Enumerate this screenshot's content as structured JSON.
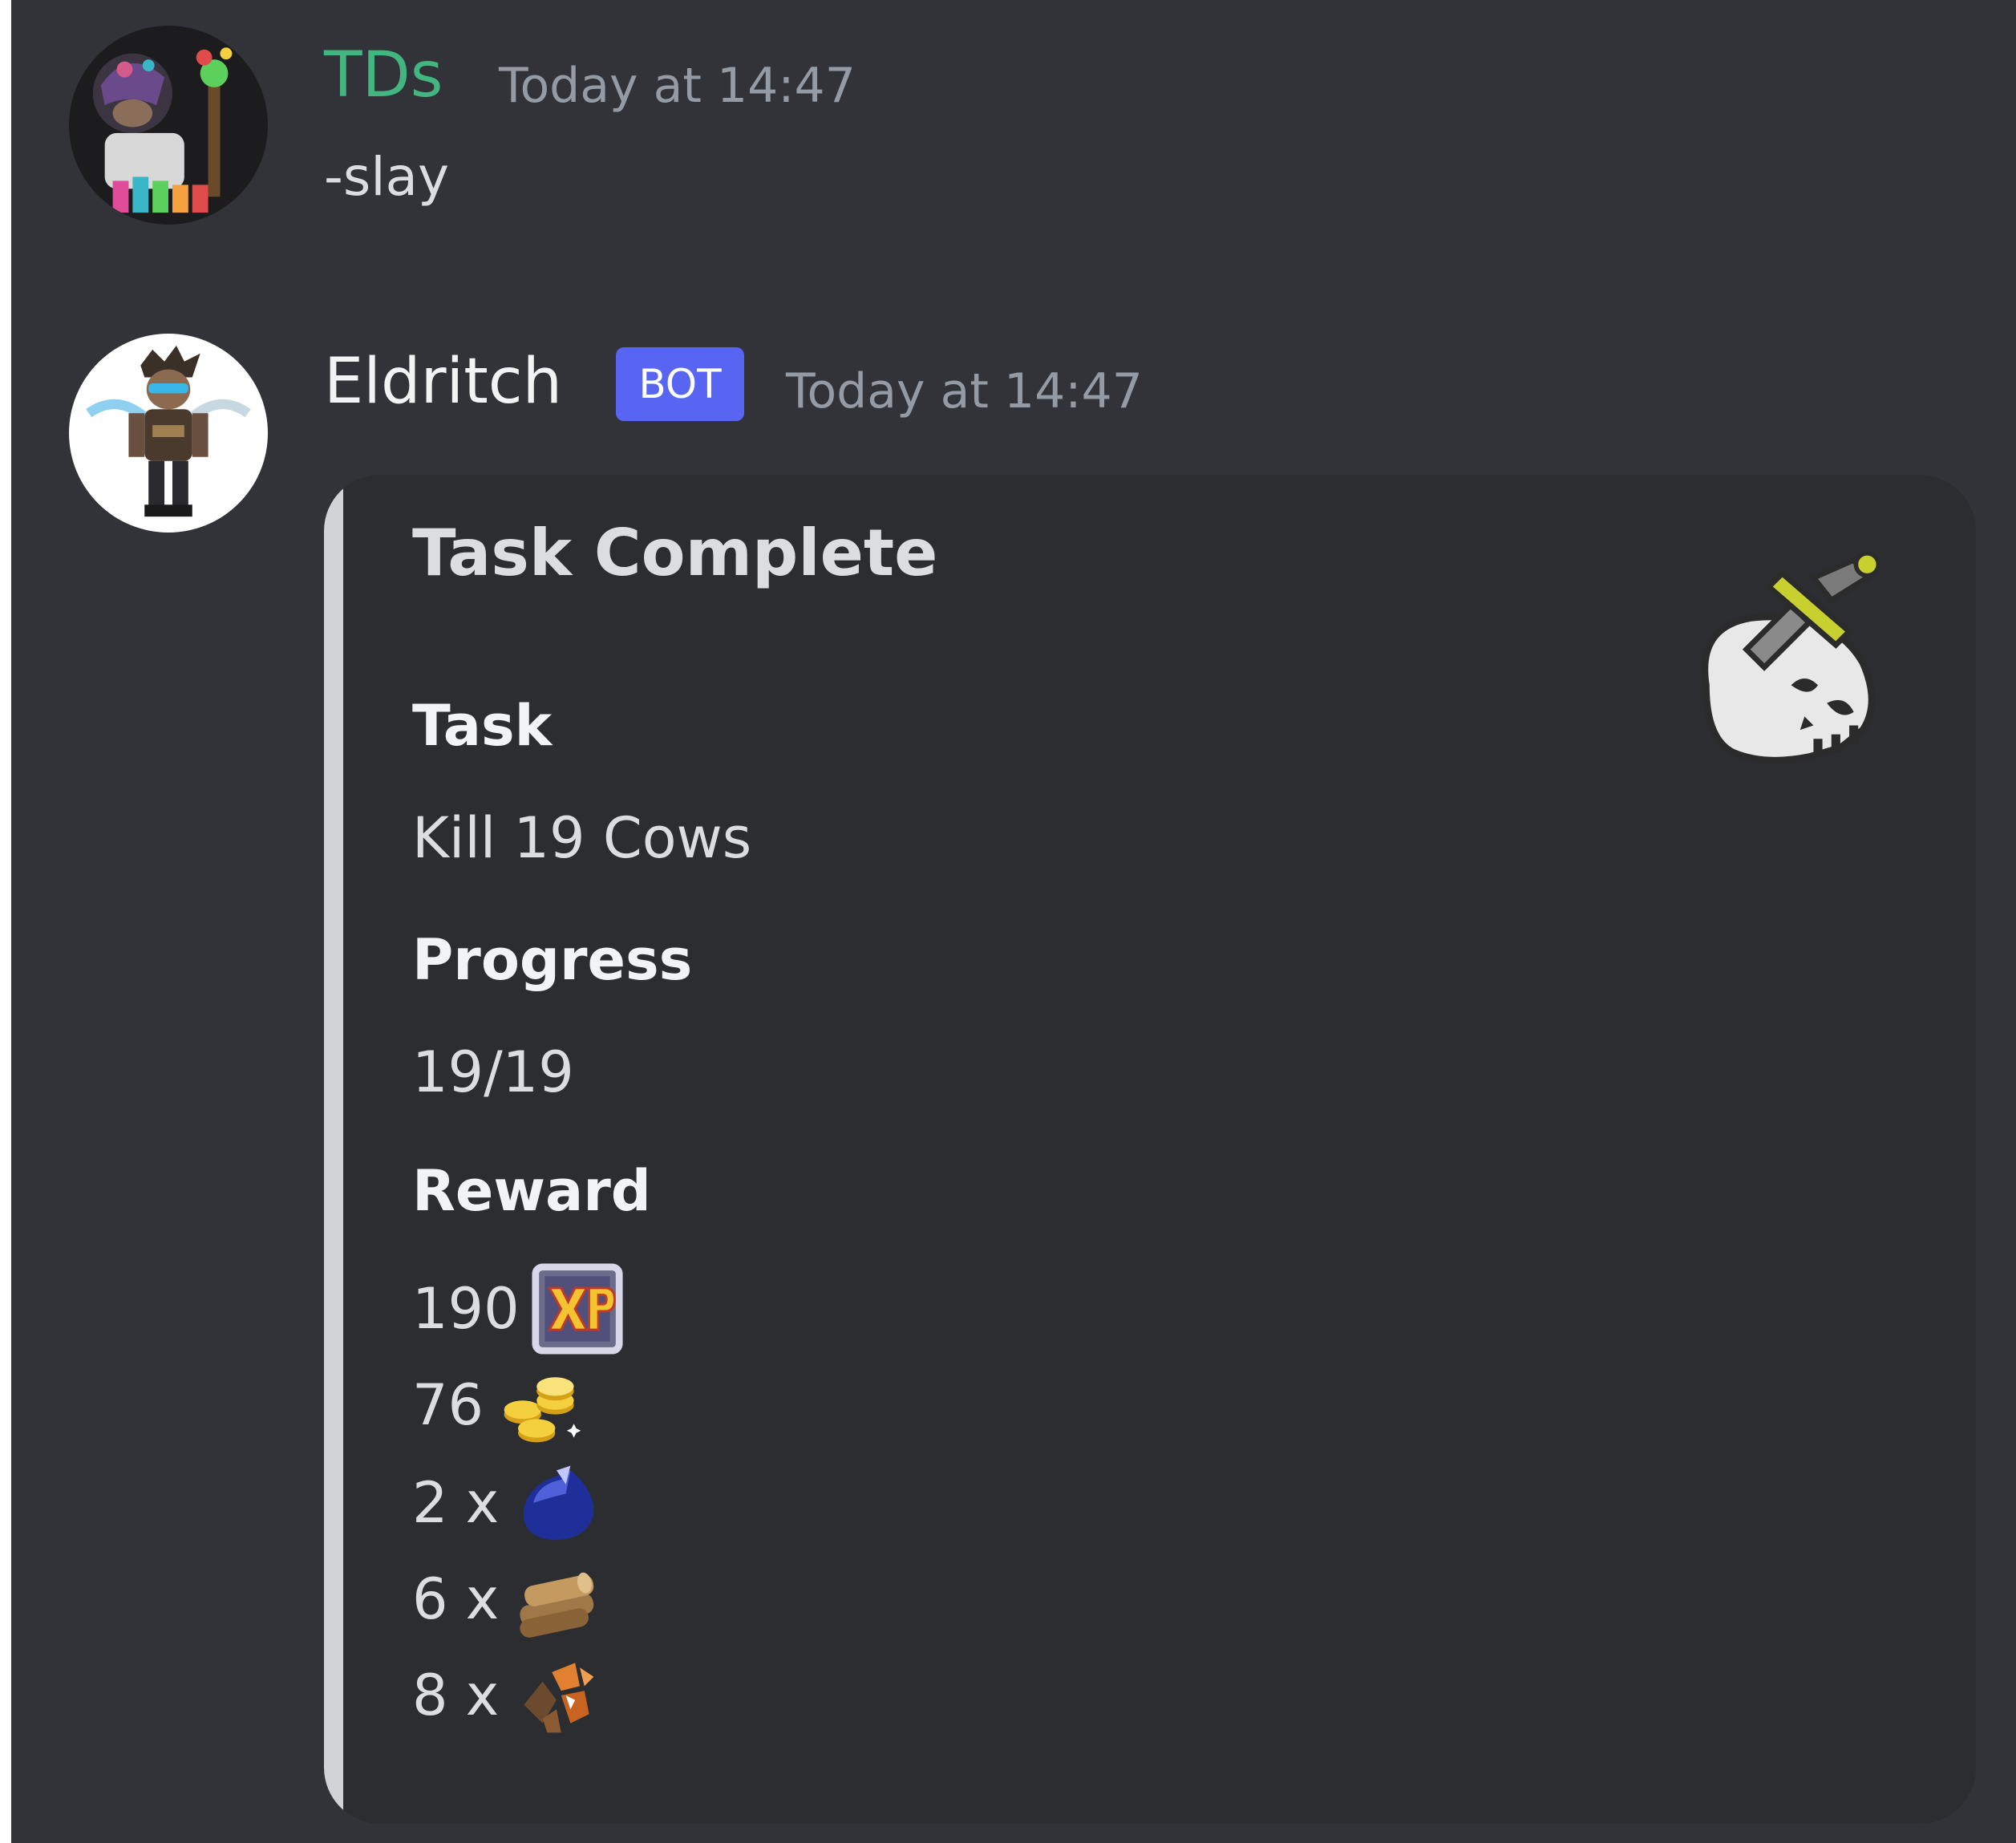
{
  "messages": [
    {
      "author": "TDs",
      "author_color": "#43b581",
      "timestamp": "Today at 14:47",
      "content": "-slay",
      "avatar_icon": "monkey-avatar"
    },
    {
      "author": "Eldritch",
      "badge": "BOT",
      "badge_color": "#5865f2",
      "timestamp": "Today at 14:47",
      "avatar_icon": "eldritch-avatar",
      "embed": {
        "title": "Task Complete",
        "thumbnail_icon": "skull-dagger-icon",
        "border_color": "#d2d3d6",
        "fields": {
          "task": {
            "name": "Task",
            "value": "Kill 19 Cows"
          },
          "progress": {
            "name": "Progress",
            "value": "19/19"
          },
          "reward": {
            "name": "Reward",
            "items": [
              {
                "text": "190",
                "icon": "xp-icon"
              },
              {
                "text": "76",
                "icon": "coins-icon"
              },
              {
                "text": "2 x",
                "icon": "sapphire-icon"
              },
              {
                "text": "6 x",
                "icon": "logs-icon"
              },
              {
                "text": "8 x",
                "icon": "copper-ore-icon"
              }
            ]
          }
        }
      }
    }
  ]
}
